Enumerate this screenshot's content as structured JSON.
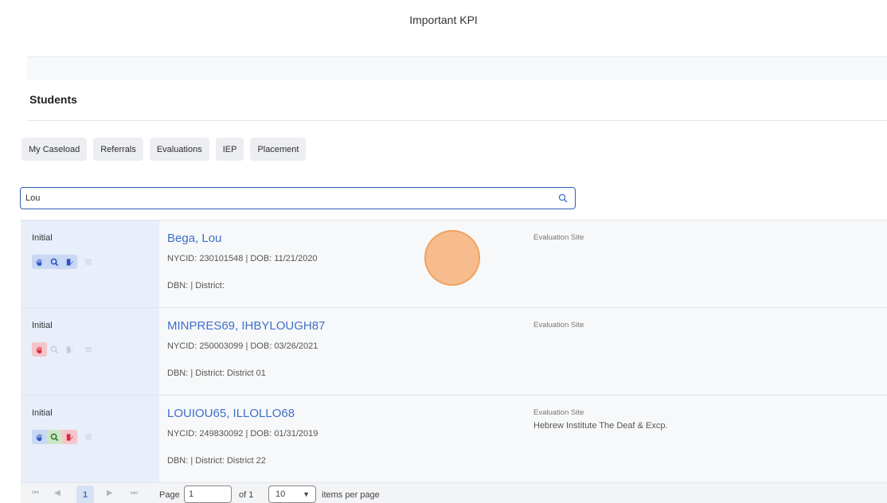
{
  "header": {
    "title": "Important KPI"
  },
  "section": {
    "title": "Students"
  },
  "tabs": [
    {
      "label": "My Caseload"
    },
    {
      "label": "Referrals"
    },
    {
      "label": "Evaluations"
    },
    {
      "label": "IEP"
    },
    {
      "label": "Placement"
    }
  ],
  "search": {
    "value": "Lou",
    "icon": "search-icon"
  },
  "students": [
    {
      "type": "Initial",
      "name": "Bega, Lou",
      "ids": "NYCID: 230101548 | DOB: 11/21/2020",
      "dbn": "DBN: | District:",
      "site_label": "Evaluation Site",
      "site_value": ""
    },
    {
      "type": "Initial",
      "name": "MINPRES69, IHBYLOUGH87",
      "ids": "NYCID: 250003099 | DOB: 03/26/2021",
      "dbn": "DBN: | District: District 01",
      "site_label": "Evaluation Site",
      "site_value": ""
    },
    {
      "type": "Initial",
      "name": "LOUIOU65, ILLOLLO68",
      "ids": "NYCID: 249830092 | DOB: 01/31/2019",
      "dbn": "DBN: | District: District 22",
      "site_label": "Evaluation Site",
      "site_value": "Hebrew Institute The Deaf & Excp."
    }
  ],
  "pager": {
    "first": "⏮",
    "prev": "◀",
    "current": "1",
    "next": "▶",
    "last": "⏭",
    "page_label": "Page",
    "page_value": "1",
    "of_label": "of 1",
    "size_value": "10",
    "size_suffix": "items per page"
  },
  "colors": {
    "accent": "#3f6fc9",
    "icon_blue": "#2f55c9",
    "icon_red": "#d9283f",
    "icon_green": "#3a7d2f"
  }
}
